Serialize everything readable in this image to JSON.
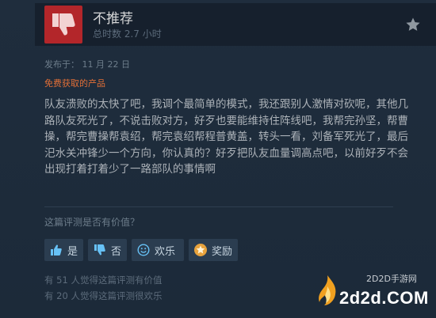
{
  "review": {
    "verdict": "不推荐",
    "hours": "总时数 2.7 小时",
    "posted": "发布于：  11 月 22 日",
    "free_label": "免费获取的产品",
    "text": "队友溃败的太快了吧，我调个最简单的模式，我还跟别人激情对砍呢，其他几路队友死光了，不说击败对方，好歹也要能维持住阵线吧，我帮完孙坚，帮曹操，帮完曹操帮袁绍，帮完袁绍帮程普黄盖，转头一看，刘备军死光了，最后汜水关冲锋少一个方向，你认真的？好歹把队友血量调高点吧，以前好歹不会出现打着打着少了一路部队的事情啊"
  },
  "feedback": {
    "question": "这篇评测是否有价值？",
    "buttons": {
      "yes": "是",
      "no": "否",
      "funny": "欢乐",
      "award": "奖励"
    },
    "helpful_count": "有 51 人觉得这篇评测有价值",
    "funny_count": "有 20 人觉得这篇评测很欢乐"
  },
  "watermark": {
    "small": "2D2D手游网",
    "big": "2d2d.COM"
  },
  "colors": {
    "background": "#1b2838",
    "thumb_bg": "#b3262a",
    "free_label": "#e26f37",
    "button_bg": "#2b3d50"
  },
  "icons": [
    "thumbs-down-icon",
    "star-icon",
    "thumbs-up-icon",
    "smiley-icon",
    "award-icon"
  ]
}
